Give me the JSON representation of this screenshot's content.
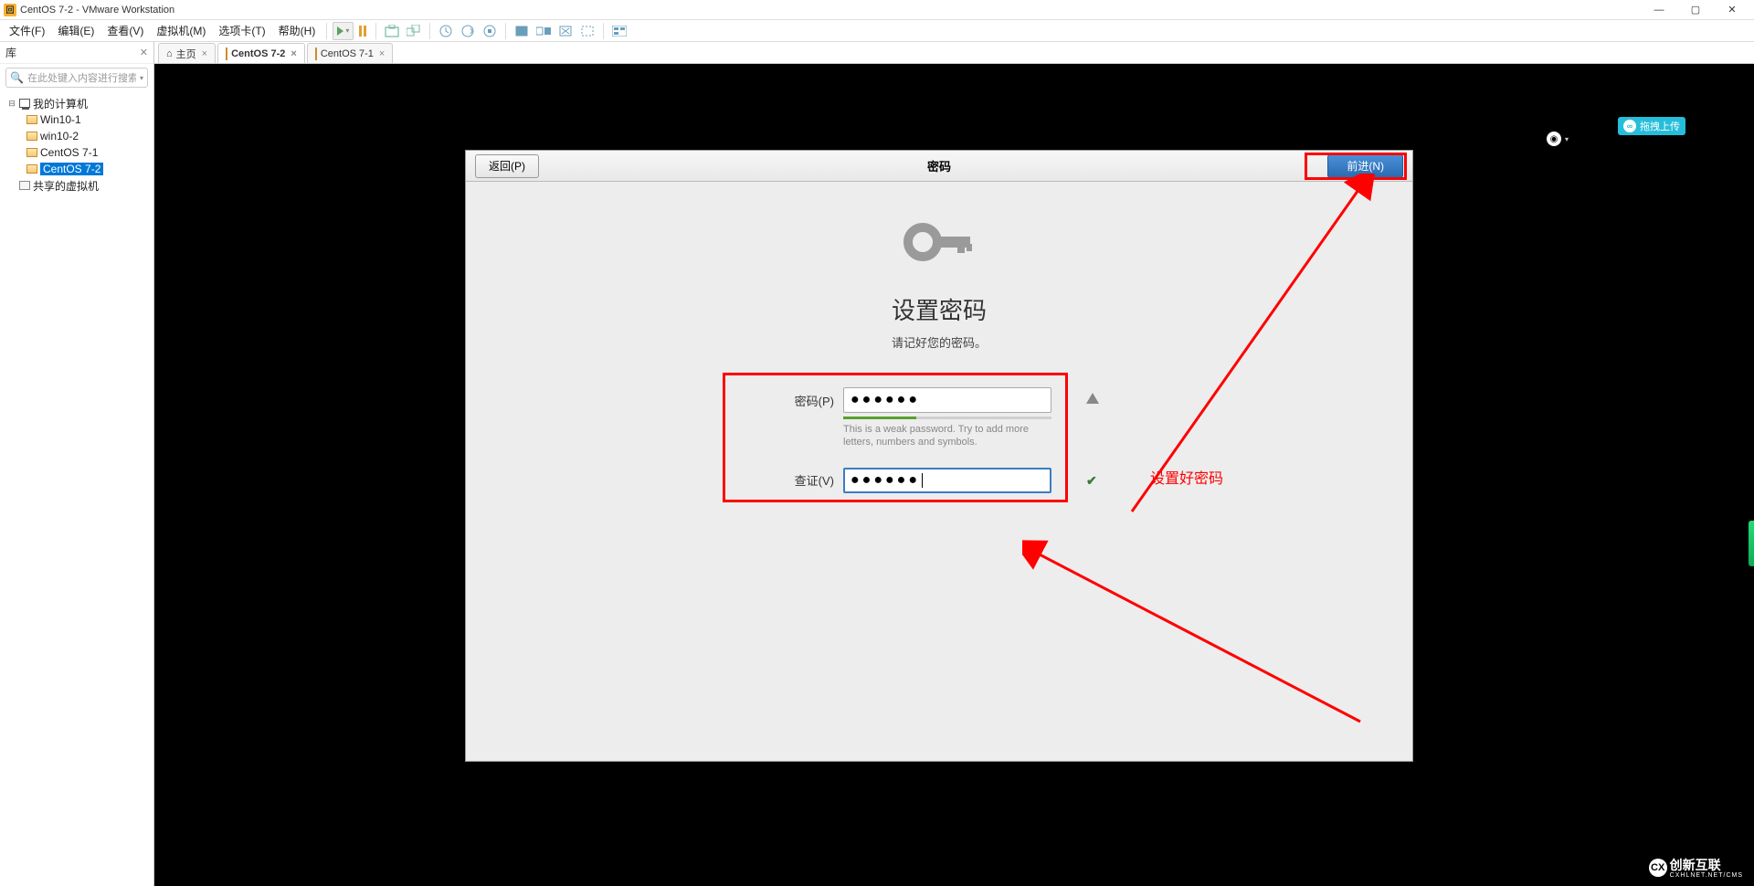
{
  "window": {
    "title": "CentOS 7-2 - VMware Workstation"
  },
  "menu": {
    "file": "文件(F)",
    "edit": "编辑(E)",
    "view": "查看(V)",
    "vm": "虚拟机(M)",
    "tabs": "选项卡(T)",
    "help": "帮助(H)"
  },
  "sidebar": {
    "library_label": "库",
    "search_placeholder": "在此处键入内容进行搜索",
    "root": "我的计算机",
    "items": [
      "Win10-1",
      "win10-2",
      "CentOS 7-1",
      "CentOS 7-2"
    ],
    "shared": "共享的虚拟机"
  },
  "tabs": [
    {
      "label": "主页",
      "kind": "home"
    },
    {
      "label": "CentOS 7-2",
      "kind": "vm",
      "active": true
    },
    {
      "label": "CentOS 7-1",
      "kind": "vm"
    }
  ],
  "panel": {
    "back": "返回(P)",
    "title": "密码",
    "forward": "前进(N)",
    "heading": "设置密码",
    "subtitle": "请记好您的密码。",
    "password_label": "密码(P)",
    "password_value": "●●●●●●",
    "weak_message": "This is a weak password. Try to add more letters, numbers and symbols.",
    "verify_label": "查证(V)",
    "verify_value": "●●●●●●"
  },
  "annotation": {
    "text": "设置好密码"
  },
  "upload": {
    "label": "拖拽上传"
  },
  "logo": {
    "main": "创新互联",
    "sub": "CXHLNET.NET/CMS"
  }
}
